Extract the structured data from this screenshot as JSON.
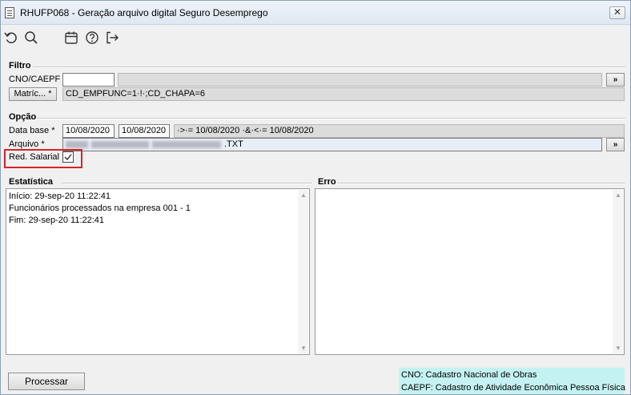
{
  "window": {
    "title": "RHUFP068 - Geração arquivo digital Seguro Desemprego",
    "close_symbol": "✕"
  },
  "toolbar": {
    "icons": [
      "undo-icon",
      "search-icon",
      "calendar-icon",
      "help-icon",
      "exit-icon"
    ]
  },
  "filtro": {
    "group_label": "Filtro",
    "cno_label": "CNO/CAEPF",
    "cno_value": "",
    "cno_desc": "",
    "lookup_button": "»",
    "matric_button": "Matríc... *",
    "matric_value": "CD_EMPFUNC=1·!·;CD_CHAPA=6"
  },
  "opcao": {
    "group_label": "Opção",
    "data_base_label": "Data base *",
    "data_inicio": "10/08/2020",
    "data_fim": "10/08/2020",
    "data_range_text": "·>·= 10/08/2020 ·&·<·= 10/08/2020",
    "arquivo_label": "Arquivo *",
    "arquivo_suffix": ".TXT",
    "arquivo_button": "»",
    "red_salarial_label": "Red. Salarial",
    "red_salarial_checked": true
  },
  "estatistica": {
    "group_label": "Estatística",
    "lines": [
      "Início: 29-sep-20 11:22:41",
      "Funcionários processados na empresa 001 - 1",
      "Fim: 29-sep-20 11:22:41"
    ]
  },
  "erro": {
    "group_label": "Erro",
    "lines": []
  },
  "footer": {
    "process_button": "Processar",
    "notes": [
      "CNO: Cadastro Nacional de Obras",
      "CAEPF: Cadastro de Atividade Econômica Pessoa Física"
    ]
  },
  "colors": {
    "highlight": "#d8232a",
    "note_background": "#c4f2f2"
  }
}
